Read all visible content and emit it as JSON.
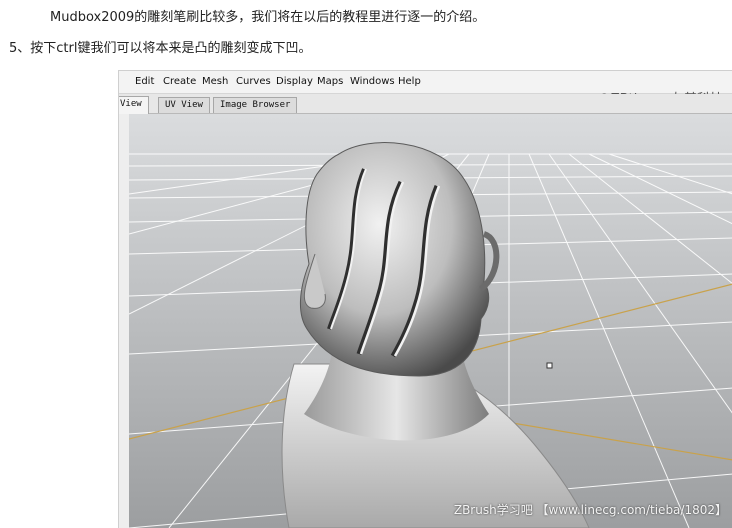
{
  "article": {
    "paragraph_1": "Mudbox2009的雕刻笔刷比较多，我们将在以后的教程里进行逐一的介绍。",
    "paragraph_2": "5、按下ctrl键我们可以将本来是凸的雕刻变成下凹。"
  },
  "screenshot": {
    "menu": [
      "Edit",
      "Create",
      "Mesh",
      "Curves",
      "Display",
      "Maps",
      "Windows",
      "Help"
    ],
    "tabs": [
      "View",
      "UV View",
      "Image Browser"
    ],
    "active_tab": "View",
    "watermark_top": "©ZBtime・友基科技",
    "watermark_bottom": "ZBrush学习吧 【www.linecg.com/tieba/1802】",
    "colors": {
      "viewport_bg_top": "#d8dadc",
      "viewport_bg_bottom": "#9fa1a3",
      "grid_line": "#ffffff",
      "axis_line": "#c9a24b",
      "model": "#b9b9b9"
    }
  }
}
